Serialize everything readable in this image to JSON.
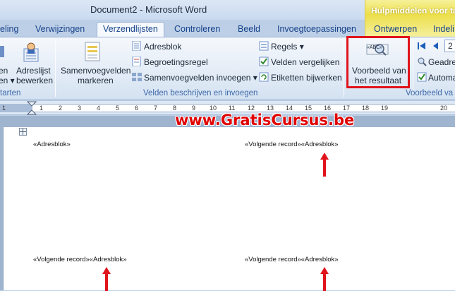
{
  "window": {
    "title": "Document2 - Microsoft Word",
    "contextual_tab_title": "Hulpmiddelen voor tabe"
  },
  "tabs": [
    {
      "label": "eling"
    },
    {
      "label": "Verwijzingen"
    },
    {
      "label": "Verzendlijsten",
      "active": true
    },
    {
      "label": "Controleren"
    },
    {
      "label": "Beeld"
    },
    {
      "label": "Invoegtoepassingen"
    },
    {
      "label": "Ontwerpen"
    },
    {
      "label": "Indeli"
    }
  ],
  "ribbon": {
    "start_group": {
      "partial_label_1": "en",
      "partial_label_2": "en ▾",
      "adreslijst_line1": "Adreslijst",
      "adreslijst_line2": "bewerken",
      "group_label": "tarten"
    },
    "fields_group": {
      "markeren_line1": "Samenvoegvelden",
      "markeren_line2": "markeren",
      "adresblok": "Adresblok",
      "begroetingsregel": "Begroetingsregel",
      "samenvoegvelden_invoegen": "Samenvoegvelden invoegen ▾",
      "regels": "Regels ▾",
      "velden_vergelijken": "Velden vergelijken",
      "etiketten_bijwerken": "Etiketten bijwerken",
      "group_label": "Velden beschrijven en invoegen"
    },
    "preview_group": {
      "preview_line1": "Voorbeeld van",
      "preview_line2": "het resultaat",
      "preview_icon_text": "«ABC»",
      "record_number": "2",
      "geadresseerde": "Geadre",
      "automatisch": "Automa",
      "group_label": "Voorbeeld va"
    }
  },
  "ruler": {
    "labels": [
      "1",
      "1",
      "2",
      "3",
      "4",
      "5",
      "6",
      "7",
      "8",
      "9",
      "10",
      "11",
      "12",
      "13",
      "14",
      "15",
      "16",
      "17",
      "18",
      "19",
      "20"
    ]
  },
  "watermark": "www.GratisCursus.be",
  "document": {
    "cells": [
      {
        "text": "«Adresblok»"
      },
      {
        "text": "«Volgende record»«Adresblok»"
      },
      {
        "text": "«Volgende record»«Adresblok»"
      },
      {
        "text": "«Volgende record»«Adresblok»"
      }
    ]
  },
  "colors": {
    "highlight_box": "#e0141c",
    "arrow": "#e0141c",
    "contextual_tab": "#ecdf4a"
  }
}
